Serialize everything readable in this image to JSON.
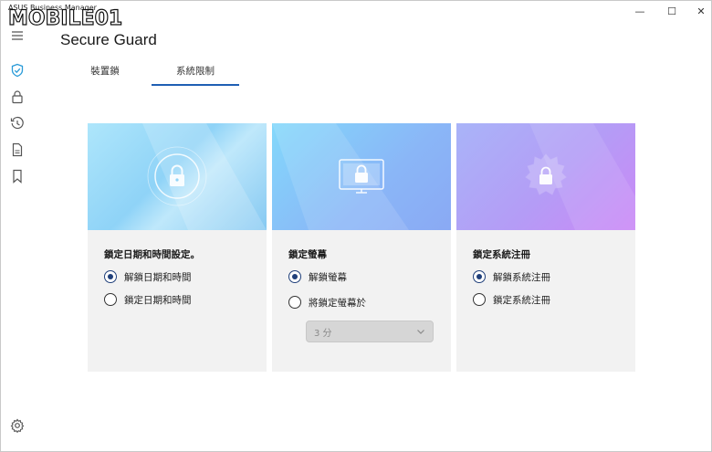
{
  "window": {
    "app_title": "ASUS Business Manager",
    "watermark": "MOBILE01",
    "controls": {
      "minimize": "—",
      "maximize": "☐",
      "close": "✕"
    }
  },
  "page": {
    "title": "Secure Guard"
  },
  "tabs": [
    {
      "label": "裝置鎖",
      "active": false
    },
    {
      "label": "系統限制",
      "active": true
    }
  ],
  "nav": {
    "items": [
      {
        "icon": "menu-icon"
      },
      {
        "icon": "shield-check-icon",
        "active": true
      },
      {
        "icon": "lock-icon"
      },
      {
        "icon": "history-icon"
      },
      {
        "icon": "document-icon"
      },
      {
        "icon": "bookmark-icon"
      }
    ],
    "bottom": {
      "icon": "settings-icon"
    }
  },
  "cards": [
    {
      "hero_icon": "lock-circle-icon",
      "title": "鎖定日期和時間設定。",
      "options": [
        {
          "label": "解鎖日期和時間",
          "selected": true
        },
        {
          "label": "鎖定日期和時間",
          "selected": false
        }
      ]
    },
    {
      "hero_icon": "lock-monitor-icon",
      "title": "鎖定螢幕",
      "options": [
        {
          "label": "解鎖螢幕",
          "selected": true
        },
        {
          "label": "將鎖定螢幕於",
          "selected": false
        }
      ],
      "select": {
        "value": "3 分",
        "disabled": true
      }
    },
    {
      "hero_icon": "lock-gear-icon",
      "title": "鎖定系統注冊",
      "options": [
        {
          "label": "解鎖系統注冊",
          "selected": true
        },
        {
          "label": "鎖定系統注冊",
          "selected": false
        }
      ]
    }
  ],
  "colors": {
    "accent": "#1f5fb4",
    "radio_selected": "#1f3f7a",
    "card_bg": "#f2f2f2",
    "nav_active": "#2a9bd8"
  }
}
